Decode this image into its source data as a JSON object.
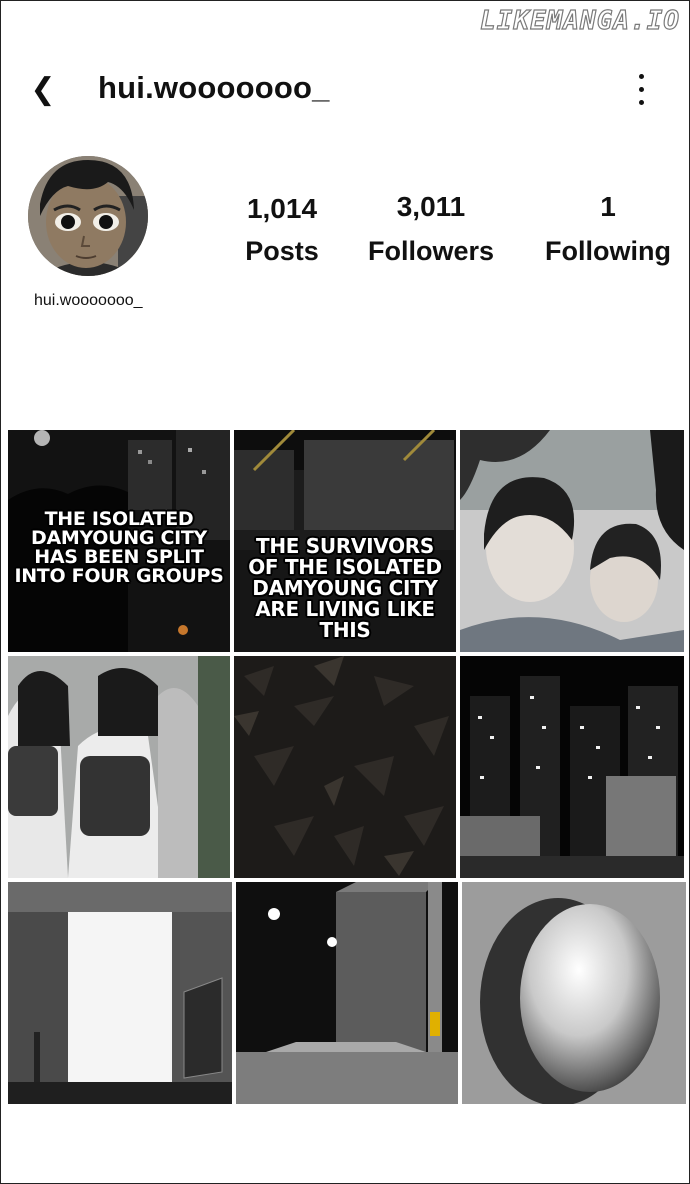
{
  "watermark": "LIKEMANGA.IO",
  "header": {
    "back_glyph": "❮",
    "username": "hui.wooooooo_",
    "menu_icon": "vertical-ellipsis-icon"
  },
  "profile": {
    "name": "hui.wooooooo_",
    "stats": [
      {
        "value": "1,014",
        "label": "Posts"
      },
      {
        "value": "3,011",
        "label": "Followers"
      },
      {
        "value": "1",
        "label": "Following"
      }
    ]
  },
  "posts": [
    {
      "caption": "THE ISOLATED DAMYOUNG CITY HAS BEEN SPLIT INTO FOUR GROUPS"
    },
    {
      "caption": "THE SURVIVORS OF THE ISOLATED DAMYOUNG CITY ARE LIVING LIKE THIS"
    },
    {
      "caption": ""
    },
    {
      "caption": ""
    },
    {
      "caption": ""
    },
    {
      "caption": ""
    },
    {
      "caption": ""
    },
    {
      "caption": ""
    },
    {
      "caption": ""
    }
  ]
}
